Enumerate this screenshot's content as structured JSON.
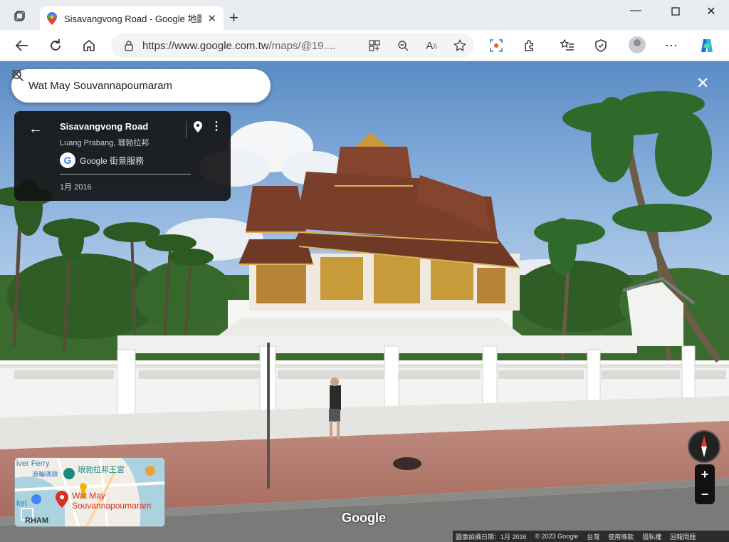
{
  "browser": {
    "tab_title": "Sisavangvong Road - Google 地圖",
    "url": "https://www.google.com.tw",
    "url_path": "/maps/@19....",
    "window_controls": [
      "minimize-icon",
      "maximize-icon",
      "close-icon"
    ],
    "toolbar_icons": [
      "back-icon",
      "refresh-icon",
      "home-icon",
      "lock-icon",
      "apps-icon",
      "zoom-icon",
      "read-aloud-icon",
      "favorite-icon",
      "screenshot-icon",
      "extensions-icon",
      "favorites-list-icon",
      "copilot-shield-icon",
      "more-icon",
      "copilot-icon"
    ]
  },
  "search": {
    "query": "Wat May Souvannapoumaram"
  },
  "info_panel": {
    "road_name": "Sisavangvong Road",
    "location": "Luang Prabang, 瑯勃拉邦",
    "service": "Google 街景服務",
    "capture_date": "1月 2016"
  },
  "minimap": {
    "label_river_ferry": "iver Ferry",
    "label_ferry_zh": "渡輪碼頭",
    "label_palace": "琅勃拉邦王宮",
    "label_target": "Wat May Souvannapoumaram",
    "label_market": "ket",
    "label_bottom": "RHAM"
  },
  "watermark": "Google",
  "footer": {
    "capture": "圖像拍攝日期：1月 2016",
    "copyright": "© 2023 Google",
    "region": "台灣",
    "terms": "使用條款",
    "privacy": "隱私權",
    "report": "回報問題"
  },
  "colors": {
    "sky_top": "#5f8fc6",
    "roof": "#7a3f2a",
    "gold": "#c79a3a",
    "wall": "#f3f3f1",
    "sidewalk": "#b5796d",
    "panel_bg": "#141414"
  }
}
